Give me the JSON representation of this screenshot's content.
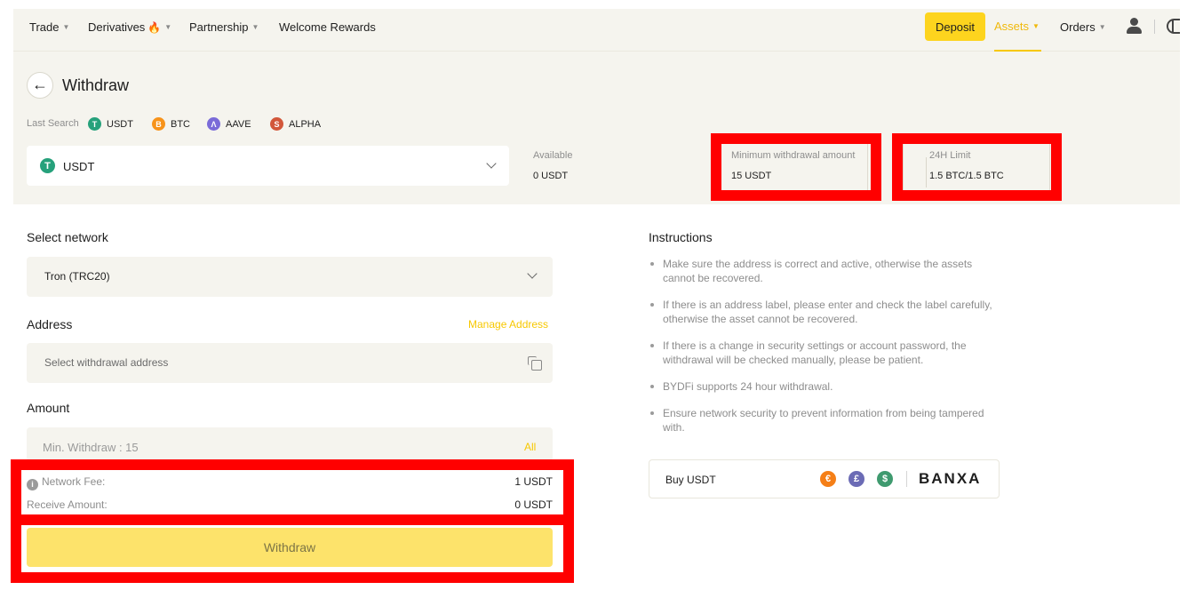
{
  "nav": {
    "trade": "Trade",
    "derivatives": "Derivatives",
    "partnership": "Partnership",
    "welcome_rewards": "Welcome Rewards",
    "deposit": "Deposit",
    "assets": "Assets",
    "orders": "Orders"
  },
  "page": {
    "title": "Withdraw"
  },
  "last_search": {
    "label": "Last Search",
    "coins": [
      {
        "symbol": "USDT",
        "color": "#26a17b",
        "glyph": "T"
      },
      {
        "symbol": "BTC",
        "color": "#f7931a",
        "glyph": "B"
      },
      {
        "symbol": "AAVE",
        "color": "#7a6bd8",
        "glyph": "Λ"
      },
      {
        "symbol": "ALPHA",
        "color": "#d2573a",
        "glyph": "S"
      }
    ]
  },
  "coin_select": {
    "value": "USDT"
  },
  "stats": {
    "available_label": "Available",
    "available_value": "0 USDT",
    "min_label": "Minimum withdrawal amount",
    "min_value": "15 USDT",
    "limit_label": "24H Limit",
    "limit_value": "1.5 BTC/1.5 BTC"
  },
  "form": {
    "network_label": "Select network",
    "network_value": "Tron (TRC20)",
    "address_label": "Address",
    "manage_address": "Manage Address",
    "address_placeholder": "Select withdrawal address",
    "amount_label": "Amount",
    "amount_placeholder": "Min. Withdraw : 15",
    "all": "All",
    "network_fee_label": "Network Fee:",
    "network_fee_value": "1 USDT",
    "receive_label": "Receive Amount:",
    "receive_value": "0 USDT",
    "withdraw_button": "Withdraw"
  },
  "instructions": {
    "title": "Instructions",
    "items": [
      "Make sure the address is correct and active, otherwise the assets cannot be recovered.",
      "If there is an address label, please enter and check the label carefully, otherwise the asset cannot be recovered.",
      "If there is a change in security settings or account password, the withdrawal will be checked manually, please be patient.",
      "BYDFi supports 24 hour withdrawal.",
      "Ensure network security to prevent information from being tampered with."
    ]
  },
  "buy": {
    "label": "Buy USDT",
    "provider": "BANXA",
    "payment_icons": [
      {
        "name": "euro-icon",
        "glyph": "€",
        "color": "#f57f17"
      },
      {
        "name": "pound-icon",
        "glyph": "£",
        "color": "#6b6bb5"
      },
      {
        "name": "dollar-icon",
        "glyph": "$",
        "color": "#3f9a6f"
      }
    ]
  },
  "colors": {
    "accent": "#fdd41e",
    "highlight": "#ff0000",
    "panel_bg": "#f5f4ee"
  }
}
